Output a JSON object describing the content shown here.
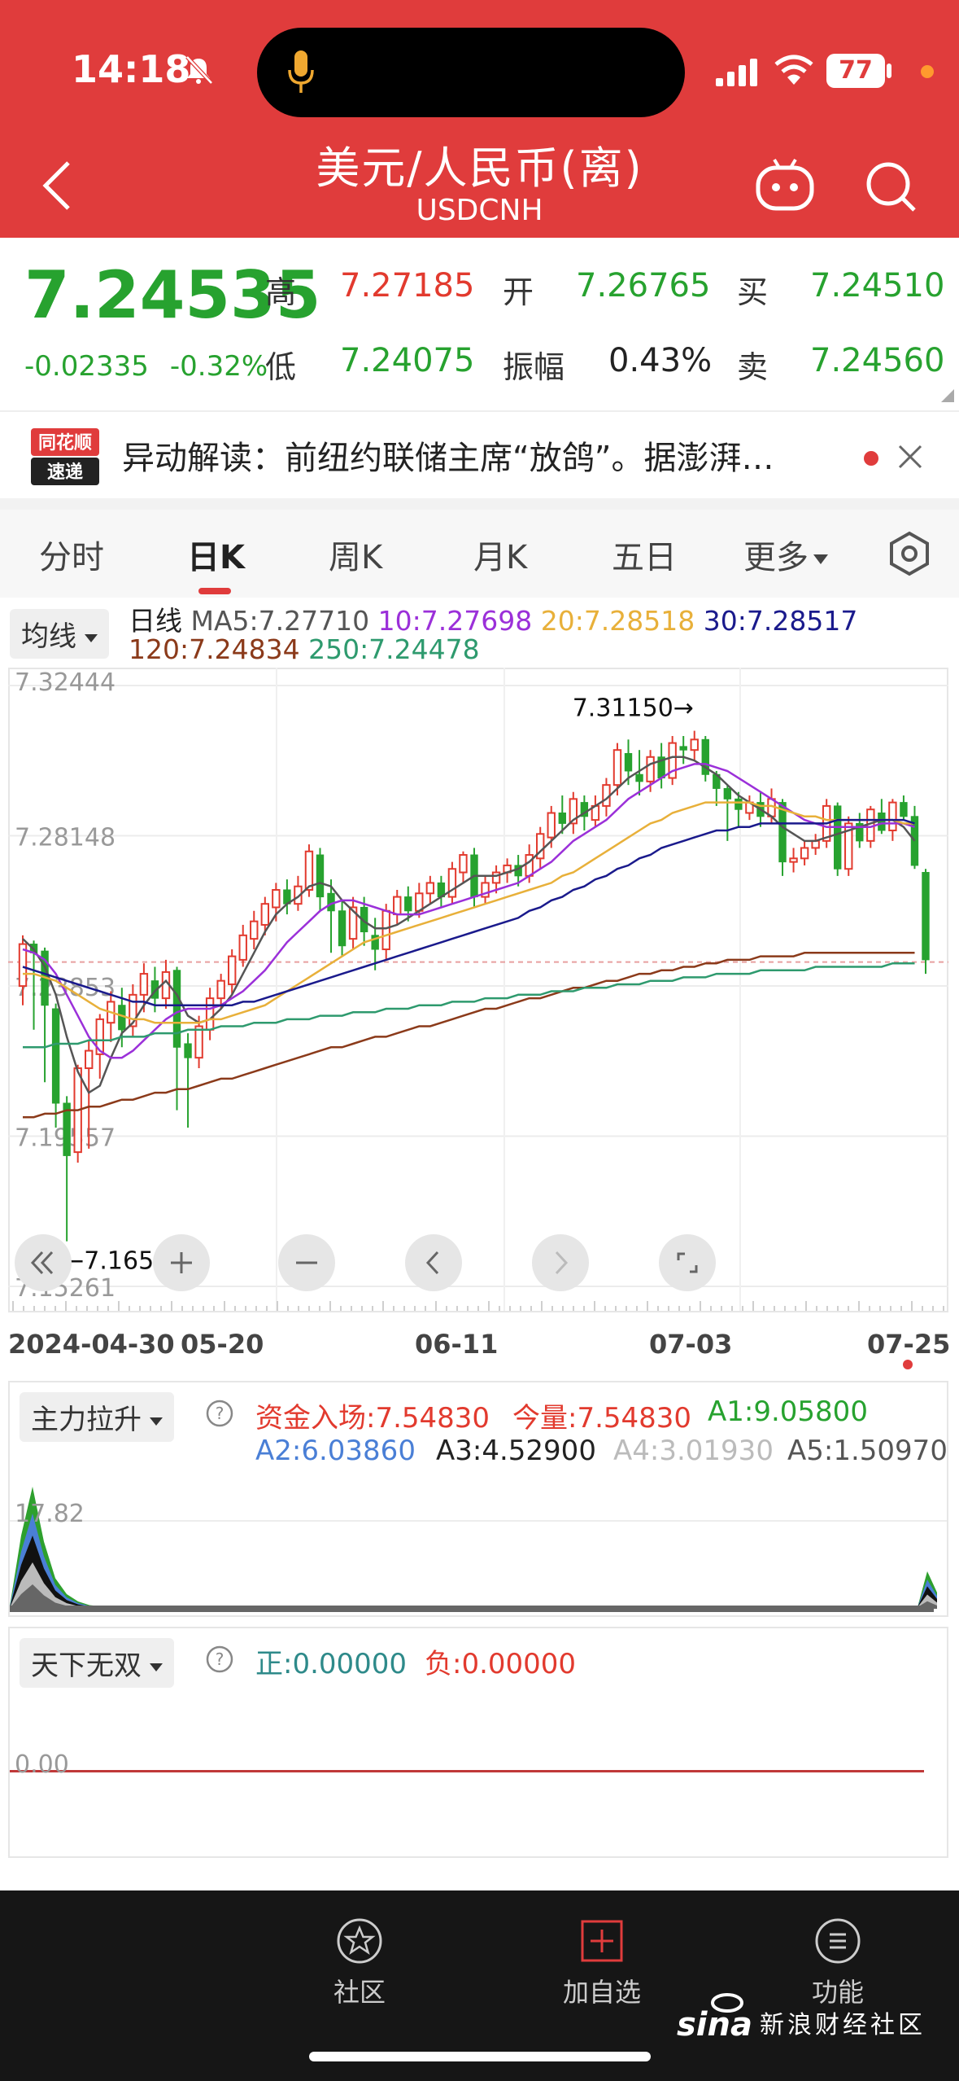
{
  "status": {
    "time": "14:18",
    "battery": "77"
  },
  "header": {
    "title": "美元/人民币(离)",
    "subtitle": "USDCNH"
  },
  "quote": {
    "price": "7.24535",
    "change": "-0.02335",
    "change_pct": "-0.32%",
    "high_label": "高",
    "high": "7.27185",
    "open_label": "开",
    "open": "7.26765",
    "buy_label": "买",
    "buy": "7.24510",
    "low_label": "低",
    "low": "7.24075",
    "amp_label": "振幅",
    "amplitude": "0.43%",
    "sell_label": "卖",
    "sell": "7.24560"
  },
  "news": {
    "logo_top": "同花顺",
    "logo_bottom": "速递",
    "text": "异动解读：前纽约联储主席“放鸽”。据澎湃…"
  },
  "tabs": [
    "分时",
    "日K",
    "周K",
    "月K",
    "五日",
    "更多"
  ],
  "ma": {
    "select": "均线",
    "label": "日线",
    "ma5": "MA5:7.27710",
    "ma10": "10:7.27698",
    "ma20": "20:7.28518",
    "ma30": "30:7.28517",
    "ma120": "120:7.24834",
    "ma250": "250:7.24478"
  },
  "colors": {
    "up": "#e23a2e",
    "down": "#27a22f",
    "ma5": "#555555",
    "ma10": "#9b30d9",
    "ma20": "#e8b03a",
    "ma30": "#1a1a8c",
    "ma120": "#8b3a1a",
    "ma250": "#2e9a6e"
  },
  "chart_data": {
    "type": "candlestick",
    "y_ticks": [
      "7.32444",
      "7.28148",
      "7.23853",
      "7.19557",
      "7.15261"
    ],
    "ylim": [
      7.15261,
      7.32444
    ],
    "x_ticks": [
      "2024-04-30",
      "05-20",
      "06-11",
      "07-03",
      "07-25"
    ],
    "max_annotation": "7.31150→",
    "min_annotation": "←7.16555",
    "candles": [
      [
        7.2385,
        7.2505,
        7.253,
        7.233
      ],
      [
        7.2505,
        7.248,
        7.2515,
        7.226
      ],
      [
        7.2485,
        7.233,
        7.2495,
        7.211
      ],
      [
        7.232,
        7.205,
        7.2335,
        7.198
      ],
      [
        7.205,
        7.19,
        7.207,
        7.1655
      ],
      [
        7.191,
        7.215,
        7.216,
        7.188
      ],
      [
        7.215,
        7.22,
        7.223,
        7.192
      ],
      [
        7.219,
        7.229,
        7.2305,
        7.212
      ],
      [
        7.228,
        7.234,
        7.237,
        7.2225
      ],
      [
        7.233,
        7.226,
        7.238,
        7.221
      ],
      [
        7.227,
        7.236,
        7.239,
        7.224
      ],
      [
        7.236,
        7.242,
        7.245,
        7.231
      ],
      [
        7.24,
        7.235,
        7.244,
        7.231
      ],
      [
        7.235,
        7.2425,
        7.246,
        7.232
      ],
      [
        7.243,
        7.221,
        7.244,
        7.203
      ],
      [
        7.222,
        7.218,
        7.225,
        7.198
      ],
      [
        7.218,
        7.227,
        7.23,
        7.215
      ],
      [
        7.226,
        7.235,
        7.238,
        7.223
      ],
      [
        7.235,
        7.24,
        7.242,
        7.232
      ],
      [
        7.239,
        7.247,
        7.249,
        7.236
      ],
      [
        7.246,
        7.253,
        7.256,
        7.244
      ],
      [
        7.252,
        7.257,
        7.26,
        7.249
      ],
      [
        7.256,
        7.262,
        7.264,
        7.253
      ],
      [
        7.261,
        7.266,
        7.268,
        7.257
      ],
      [
        7.266,
        7.262,
        7.269,
        7.259
      ],
      [
        7.262,
        7.267,
        7.27,
        7.26
      ],
      [
        7.266,
        7.277,
        7.279,
        7.264
      ],
      [
        7.276,
        7.264,
        7.278,
        7.26
      ],
      [
        7.265,
        7.26,
        7.269,
        7.248
      ],
      [
        7.26,
        7.25,
        7.263,
        7.247
      ],
      [
        7.252,
        7.261,
        7.264,
        7.249
      ],
      [
        7.261,
        7.254,
        7.264,
        7.25
      ],
      [
        7.253,
        7.249,
        7.258,
        7.243
      ],
      [
        7.249,
        7.26,
        7.262,
        7.246
      ],
      [
        7.259,
        7.264,
        7.266,
        7.256
      ],
      [
        7.264,
        7.26,
        7.267,
        7.257
      ],
      [
        7.26,
        7.265,
        7.268,
        7.258
      ],
      [
        7.265,
        7.268,
        7.27,
        7.262
      ],
      [
        7.268,
        7.264,
        7.27,
        7.261
      ],
      [
        7.264,
        7.272,
        7.274,
        7.262
      ],
      [
        7.271,
        7.276,
        7.277,
        7.268
      ],
      [
        7.276,
        7.264,
        7.278,
        7.261
      ],
      [
        7.264,
        7.268,
        7.27,
        7.262
      ],
      [
        7.268,
        7.271,
        7.273,
        7.265
      ],
      [
        7.271,
        7.273,
        7.275,
        7.268
      ],
      [
        7.273,
        7.27,
        7.276,
        7.267
      ],
      [
        7.27,
        7.276,
        7.279,
        7.268
      ],
      [
        7.275,
        7.282,
        7.284,
        7.272
      ],
      [
        7.281,
        7.288,
        7.29,
        7.278
      ],
      [
        7.288,
        7.285,
        7.293,
        7.282
      ],
      [
        7.285,
        7.292,
        7.294,
        7.282
      ],
      [
        7.291,
        7.287,
        7.293,
        7.283
      ],
      [
        7.286,
        7.29,
        7.293,
        7.284
      ],
      [
        7.29,
        7.296,
        7.298,
        7.287
      ],
      [
        7.296,
        7.306,
        7.308,
        7.293
      ],
      [
        7.305,
        7.3,
        7.309,
        7.296
      ],
      [
        7.299,
        7.297,
        7.306,
        7.293
      ],
      [
        7.297,
        7.304,
        7.306,
        7.294
      ],
      [
        7.304,
        7.298,
        7.308,
        7.295
      ],
      [
        7.298,
        7.308,
        7.31,
        7.296
      ],
      [
        7.307,
        7.306,
        7.31,
        7.302
      ],
      [
        7.306,
        7.309,
        7.3115,
        7.303
      ],
      [
        7.309,
        7.299,
        7.31,
        7.297
      ],
      [
        7.299,
        7.295,
        7.3,
        7.29
      ],
      [
        7.295,
        7.292,
        7.296,
        7.28
      ],
      [
        7.292,
        7.289,
        7.294,
        7.284
      ],
      [
        7.288,
        7.291,
        7.293,
        7.286
      ],
      [
        7.291,
        7.287,
        7.294,
        7.284
      ],
      [
        7.287,
        7.292,
        7.295,
        7.285
      ],
      [
        7.291,
        7.274,
        7.292,
        7.27
      ],
      [
        7.274,
        7.275,
        7.278,
        7.271
      ],
      [
        7.275,
        7.278,
        7.28,
        7.273
      ],
      [
        7.278,
        7.28,
        7.282,
        7.276
      ],
      [
        7.28,
        7.29,
        7.292,
        7.278
      ],
      [
        7.29,
        7.272,
        7.291,
        7.27
      ],
      [
        7.272,
        7.285,
        7.287,
        7.27
      ],
      [
        7.285,
        7.28,
        7.288,
        7.278
      ],
      [
        7.28,
        7.289,
        7.29,
        7.278
      ],
      [
        7.288,
        7.283,
        7.292,
        7.282
      ],
      [
        7.283,
        7.291,
        7.292,
        7.28
      ],
      [
        7.291,
        7.287,
        7.293,
        7.286
      ],
      [
        7.287,
        7.273,
        7.29,
        7.272
      ],
      [
        7.271,
        7.246,
        7.272,
        7.242
      ]
    ],
    "series": [
      {
        "name": "MA5",
        "values": [
          7.252,
          7.249,
          7.244,
          7.236,
          7.224,
          7.214,
          7.208,
          7.21,
          7.218,
          7.225,
          7.228,
          7.233,
          7.237,
          7.24,
          7.236,
          7.23,
          7.228,
          7.229,
          7.232,
          7.236,
          7.242,
          7.248,
          7.254,
          7.259,
          7.262,
          7.264,
          7.267,
          7.268,
          7.267,
          7.263,
          7.26,
          7.257,
          7.255,
          7.255,
          7.256,
          7.258,
          7.26,
          7.262,
          7.264,
          7.266,
          7.268,
          7.27,
          7.27,
          7.27,
          7.271,
          7.272,
          7.274,
          7.277,
          7.28,
          7.283,
          7.286,
          7.288,
          7.29,
          7.292,
          7.295,
          7.298,
          7.3,
          7.302,
          7.303,
          7.304,
          7.304,
          7.303,
          7.301,
          7.299,
          7.296,
          7.293,
          7.291,
          7.289,
          7.287,
          7.284,
          7.282,
          7.28,
          7.28,
          7.281,
          7.282,
          7.283,
          7.284,
          7.285,
          7.286,
          7.286,
          7.284,
          7.28
        ]
      },
      {
        "name": "MA10",
        "values": [
          7.249,
          7.248,
          7.246,
          7.242,
          7.236,
          7.23,
          7.224,
          7.22,
          7.218,
          7.218,
          7.22,
          7.223,
          7.226,
          7.229,
          7.231,
          7.232,
          7.232,
          7.232,
          7.233,
          7.235,
          7.237,
          7.24,
          7.243,
          7.247,
          7.251,
          7.254,
          7.257,
          7.26,
          7.262,
          7.263,
          7.263,
          7.262,
          7.261,
          7.26,
          7.259,
          7.259,
          7.259,
          7.26,
          7.261,
          7.262,
          7.263,
          7.264,
          7.265,
          7.266,
          7.267,
          7.268,
          7.27,
          7.272,
          7.274,
          7.277,
          7.28,
          7.282,
          7.284,
          7.286,
          7.289,
          7.292,
          7.294,
          7.296,
          7.298,
          7.3,
          7.301,
          7.302,
          7.302,
          7.301,
          7.3,
          7.298,
          7.296,
          7.294,
          7.292,
          7.29,
          7.288,
          7.286,
          7.285,
          7.284,
          7.284,
          7.284,
          7.284,
          7.284,
          7.285,
          7.285,
          7.285,
          7.284
        ]
      },
      {
        "name": "MA20",
        "values": [
          7.242,
          7.242,
          7.241,
          7.24,
          7.238,
          7.236,
          7.234,
          7.232,
          7.231,
          7.23,
          7.229,
          7.229,
          7.228,
          7.228,
          7.228,
          7.228,
          7.228,
          7.229,
          7.229,
          7.23,
          7.231,
          7.232,
          7.233,
          7.235,
          7.237,
          7.239,
          7.241,
          7.243,
          7.245,
          7.247,
          7.249,
          7.251,
          7.252,
          7.253,
          7.254,
          7.255,
          7.256,
          7.257,
          7.258,
          7.259,
          7.26,
          7.261,
          7.262,
          7.263,
          7.264,
          7.265,
          7.266,
          7.267,
          7.268,
          7.27,
          7.271,
          7.273,
          7.275,
          7.277,
          7.279,
          7.281,
          7.283,
          7.285,
          7.286,
          7.288,
          7.289,
          7.29,
          7.291,
          7.291,
          7.291,
          7.291,
          7.291,
          7.29,
          7.29,
          7.289,
          7.288,
          7.287,
          7.287,
          7.286,
          7.286,
          7.286,
          7.286,
          7.286,
          7.286,
          7.286,
          7.285,
          7.285
        ]
      },
      {
        "name": "MA30",
        "values": [
          7.244,
          7.243,
          7.242,
          7.241,
          7.24,
          7.239,
          7.238,
          7.237,
          7.236,
          7.235,
          7.234,
          7.234,
          7.233,
          7.233,
          7.233,
          7.233,
          7.233,
          7.233,
          7.233,
          7.233,
          7.234,
          7.234,
          7.235,
          7.236,
          7.237,
          7.238,
          7.239,
          7.24,
          7.241,
          7.242,
          7.243,
          7.244,
          7.245,
          7.246,
          7.247,
          7.248,
          7.249,
          7.25,
          7.251,
          7.252,
          7.253,
          7.254,
          7.255,
          7.256,
          7.257,
          7.258,
          7.26,
          7.261,
          7.263,
          7.264,
          7.266,
          7.267,
          7.269,
          7.27,
          7.272,
          7.273,
          7.275,
          7.276,
          7.278,
          7.279,
          7.28,
          7.281,
          7.282,
          7.283,
          7.283,
          7.284,
          7.284,
          7.285,
          7.285,
          7.285,
          7.285,
          7.285,
          7.285,
          7.285,
          7.286,
          7.286,
          7.286,
          7.286,
          7.286,
          7.286,
          7.286,
          7.285
        ]
      },
      {
        "name": "MA120",
        "values": [
          7.201,
          7.201,
          7.202,
          7.202,
          7.203,
          7.203,
          7.204,
          7.204,
          7.205,
          7.206,
          7.206,
          7.207,
          7.208,
          7.208,
          7.209,
          7.209,
          7.21,
          7.211,
          7.212,
          7.212,
          7.213,
          7.214,
          7.215,
          7.216,
          7.217,
          7.218,
          7.219,
          7.22,
          7.221,
          7.221,
          7.222,
          7.223,
          7.224,
          7.224,
          7.225,
          7.226,
          7.227,
          7.227,
          7.228,
          7.229,
          7.23,
          7.231,
          7.232,
          7.232,
          7.233,
          7.234,
          7.235,
          7.235,
          7.236,
          7.237,
          7.238,
          7.238,
          7.239,
          7.24,
          7.24,
          7.241,
          7.242,
          7.242,
          7.243,
          7.243,
          7.244,
          7.244,
          7.245,
          7.245,
          7.246,
          7.246,
          7.246,
          7.247,
          7.247,
          7.247,
          7.247,
          7.248,
          7.248,
          7.248,
          7.248,
          7.248,
          7.248,
          7.248,
          7.248,
          7.248,
          7.248,
          7.248
        ]
      },
      {
        "name": "MA250",
        "values": [
          7.221,
          7.221,
          7.221,
          7.222,
          7.222,
          7.222,
          7.223,
          7.223,
          7.223,
          7.224,
          7.224,
          7.224,
          7.225,
          7.225,
          7.225,
          7.226,
          7.226,
          7.226,
          7.227,
          7.227,
          7.227,
          7.228,
          7.228,
          7.228,
          7.229,
          7.229,
          7.229,
          7.23,
          7.23,
          7.23,
          7.231,
          7.231,
          7.231,
          7.232,
          7.232,
          7.232,
          7.233,
          7.233,
          7.233,
          7.234,
          7.234,
          7.234,
          7.235,
          7.235,
          7.235,
          7.236,
          7.236,
          7.236,
          7.237,
          7.237,
          7.237,
          7.238,
          7.238,
          7.238,
          7.239,
          7.239,
          7.239,
          7.24,
          7.24,
          7.24,
          7.241,
          7.241,
          7.241,
          7.242,
          7.242,
          7.242,
          7.242,
          7.243,
          7.243,
          7.243,
          7.243,
          7.243,
          7.244,
          7.244,
          7.244,
          7.244,
          7.244,
          7.244,
          7.244,
          7.245,
          7.245,
          7.245
        ]
      }
    ]
  },
  "controls": [
    "rewind",
    "zoom-in",
    "zoom-out",
    "prev",
    "next",
    "fullscreen"
  ],
  "indicator1": {
    "select": "主力拉升",
    "fund": "资金入场:7.54830",
    "volume": "今量:7.54830",
    "a1": "A1:9.05800",
    "a2": "A2:6.03860",
    "a3": "A3:4.52900",
    "a4": "A4:3.01930",
    "a5": "A5:1.50970",
    "ytick": "17.82",
    "peak_series": [
      0.02,
      0.6,
      1.0,
      0.55,
      0.25,
      0.12,
      0.06,
      0.03,
      0.02,
      0.01
    ]
  },
  "indicator2": {
    "select": "天下无双",
    "pos": "正:0.00000",
    "neg": "负:0.00000",
    "ytick": "0.00"
  },
  "bottom_nav": [
    {
      "label": "社区",
      "icon": "star-circle-icon"
    },
    {
      "label": "加自选",
      "icon": "plus-box-icon"
    },
    {
      "label": "功能",
      "icon": "menu-circle-icon"
    }
  ],
  "watermark": {
    "logo": "sina",
    "text": "新浪财经社区"
  }
}
